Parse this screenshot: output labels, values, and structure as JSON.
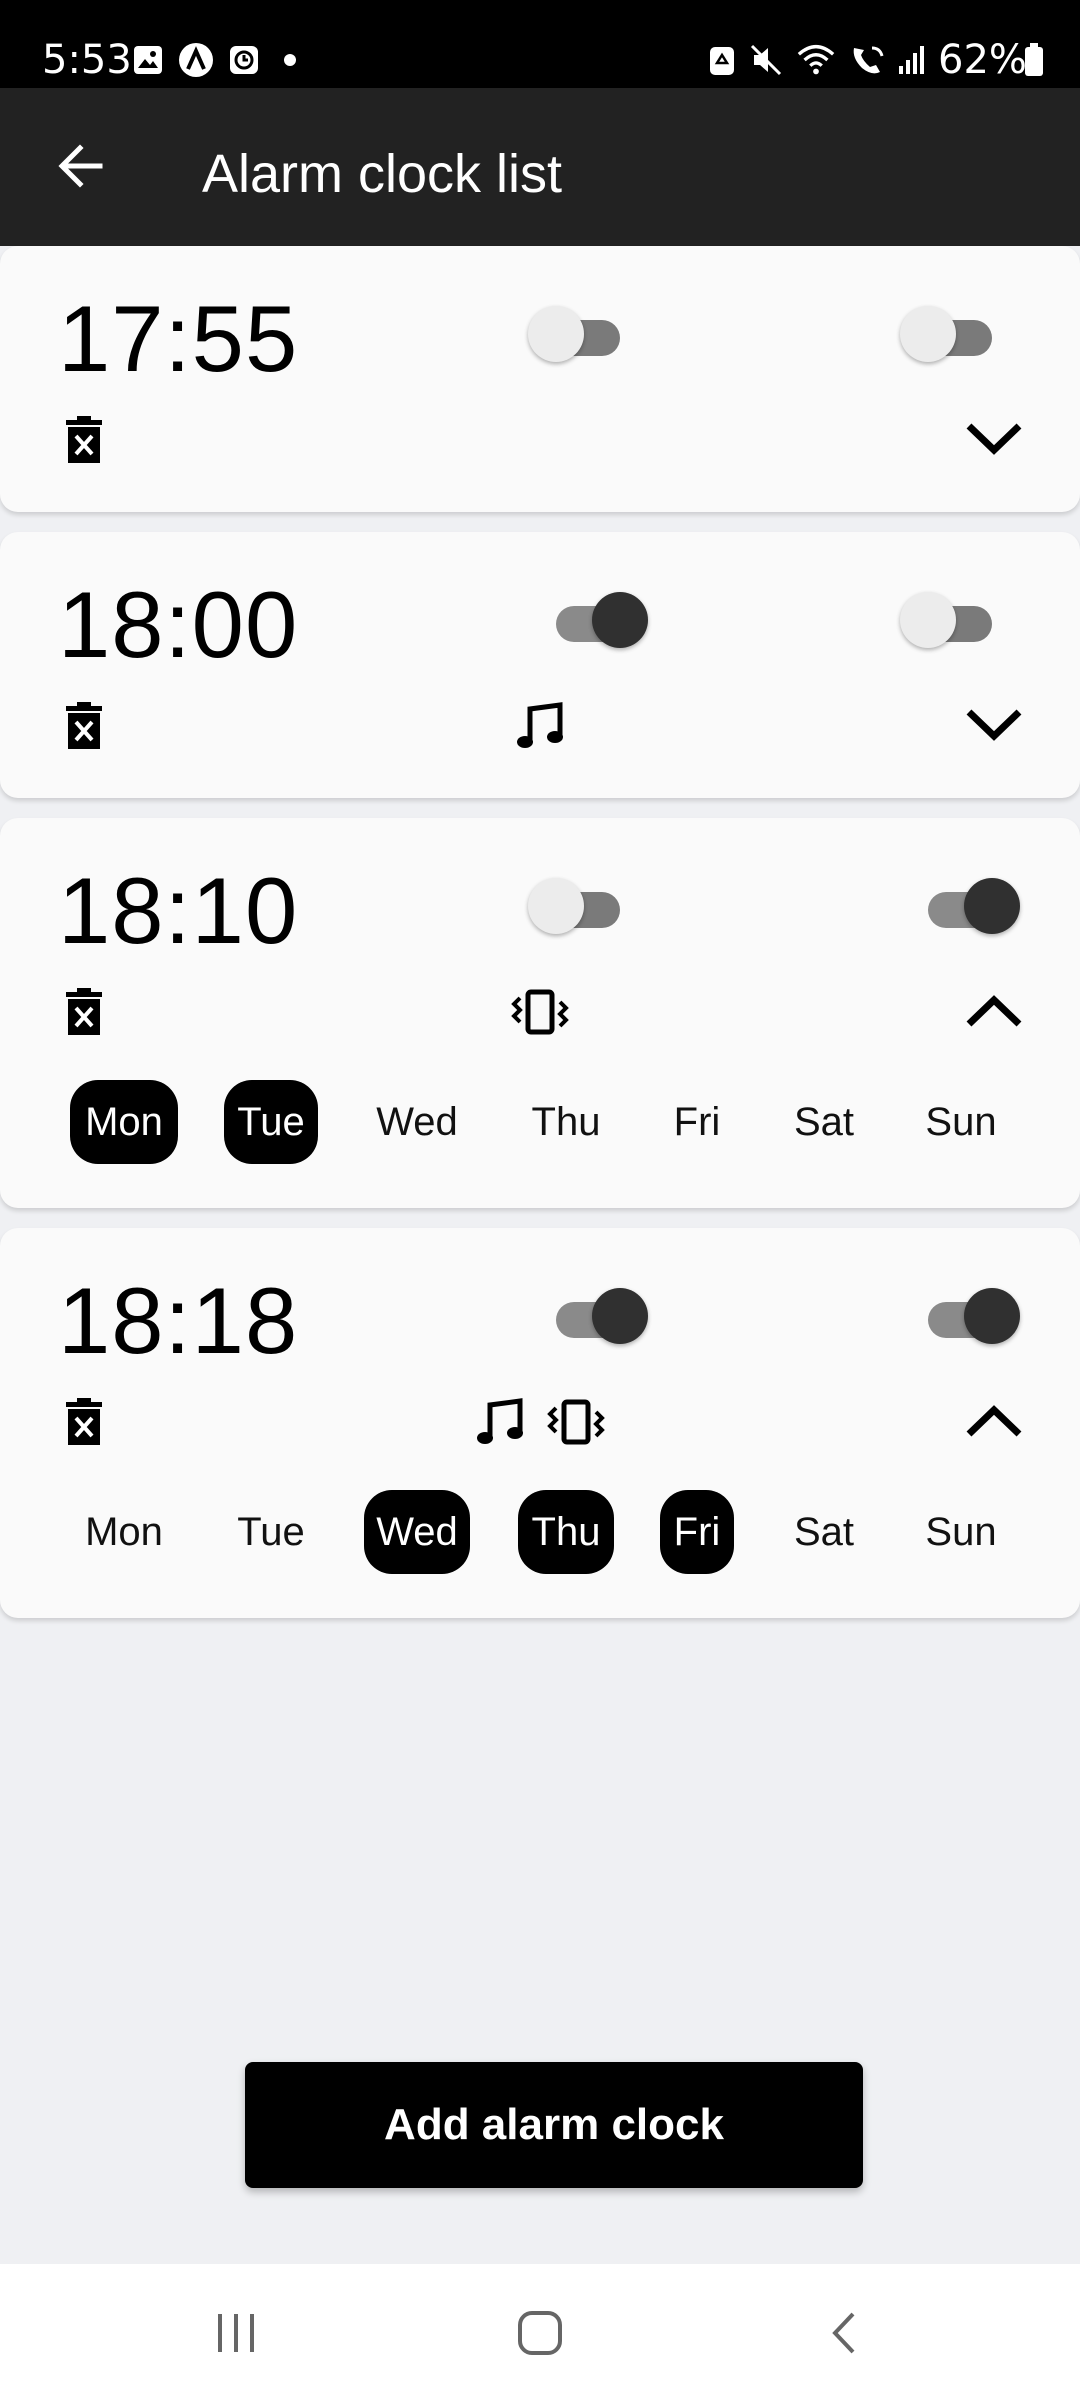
{
  "status_bar": {
    "time": "5:53",
    "battery": "62%",
    "icons": [
      "gallery-icon",
      "app-a-icon",
      "app-clock-icon",
      "dot-icon",
      "recycle-icon",
      "mute-icon",
      "wifi-icon",
      "wifi-call-icon",
      "signal-icon",
      "battery-icon"
    ]
  },
  "app_bar": {
    "title": "Alarm clock list",
    "back_icon": "arrow-left-icon"
  },
  "alarms": [
    {
      "time": "17:55",
      "switch_a": false,
      "switch_b": false,
      "sound": false,
      "vibrate": false,
      "expanded": false
    },
    {
      "time": "18:00",
      "switch_a": true,
      "switch_b": false,
      "sound": true,
      "vibrate": false,
      "expanded": false
    },
    {
      "time": "18:10",
      "switch_a": false,
      "switch_b": true,
      "sound": false,
      "vibrate": true,
      "expanded": true,
      "days": [
        "Mon",
        "Tue",
        "Wed",
        "Thu",
        "Fri",
        "Sat",
        "Sun"
      ],
      "selected_days": [
        "Mon",
        "Tue"
      ]
    },
    {
      "time": "18:18",
      "switch_a": true,
      "switch_b": true,
      "sound": true,
      "vibrate": true,
      "expanded": true,
      "days": [
        "Mon",
        "Tue",
        "Wed",
        "Thu",
        "Fri",
        "Sat",
        "Sun"
      ],
      "selected_days": [
        "Wed",
        "Thu",
        "Fri"
      ]
    }
  ],
  "add_button": {
    "label": "Add alarm clock"
  },
  "nav_bar": {
    "icons": [
      "recent-apps-icon",
      "home-icon",
      "back-icon"
    ]
  },
  "colors": {
    "status_bar": "#000000",
    "app_bar": "#222222",
    "background": "#eff0f3",
    "card": "#fafafa",
    "accent": "#000000"
  }
}
